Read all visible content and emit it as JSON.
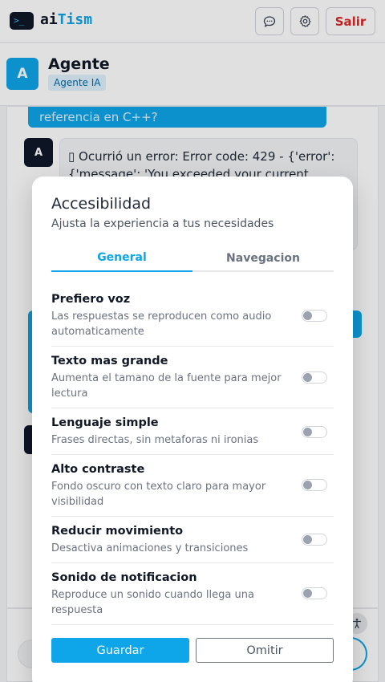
{
  "header": {
    "logo_glyph": ">_",
    "brand_ai": "ai",
    "brand_tism": "Tism",
    "chat_icon": "chat-bubble-icon",
    "settings_icon": "gear-icon",
    "exit_label": "Salir"
  },
  "agent": {
    "avatar_letter": "A",
    "name": "Agente",
    "badge": "Agente IA"
  },
  "chat": {
    "user_message_fragment": "referencia en C++?",
    "bot_avatar_letter": "A",
    "bot_message": "▯ Ocurrió un error: Error code: 429 - {'error': {'message': 'You exceeded your current"
  },
  "modal": {
    "title": "Accesibilidad",
    "subtitle": "Ajusta la experiencia a tus necesidades",
    "tabs": [
      {
        "label": "General",
        "active": true
      },
      {
        "label": "Navegacion",
        "active": false
      }
    ],
    "options": [
      {
        "title": "Prefiero voz",
        "desc": "Las respuestas se reproducen como audio automaticamente",
        "enabled": false
      },
      {
        "title": "Texto mas grande",
        "desc": "Aumenta el tamano de la fuente para mejor lectura",
        "enabled": false
      },
      {
        "title": "Lenguaje simple",
        "desc": "Frases directas, sin metaforas ni ironias",
        "enabled": false
      },
      {
        "title": "Alto contraste",
        "desc": "Fondo oscuro con texto claro para mayor visibilidad",
        "enabled": false
      },
      {
        "title": "Reducir movimiento",
        "desc": "Desactiva animaciones y transiciones",
        "enabled": false
      },
      {
        "title": "Sonido de notificacion",
        "desc": "Reproduce un sonido cuando llega una respuesta",
        "enabled": false
      }
    ],
    "save_label": "Guardar",
    "skip_label": "Omitir"
  },
  "colors": {
    "accent": "#0ea5e9",
    "danger": "#dc2626",
    "dark": "#0f172a"
  }
}
